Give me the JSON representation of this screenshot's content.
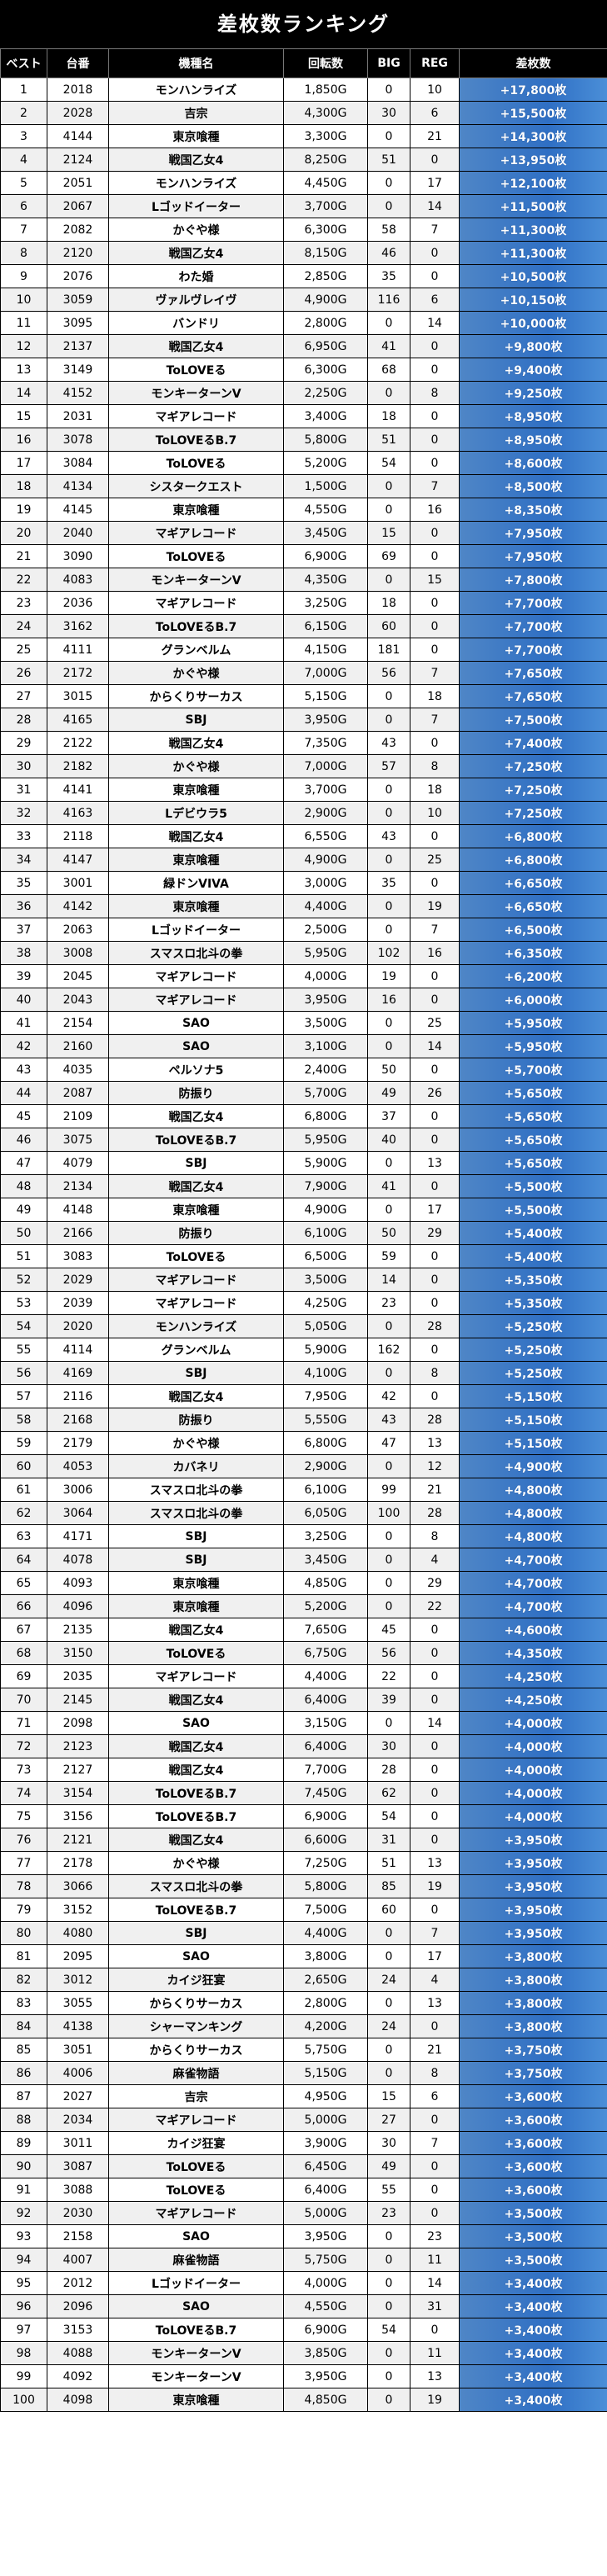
{
  "title": "差枚数ランキング",
  "headers": {
    "rank": "ベスト",
    "no": "台番",
    "model": "機種名",
    "spins": "回転数",
    "big": "BIG",
    "reg": "REG",
    "diff": "差枚数"
  },
  "rows": [
    [
      "1",
      "2018",
      "モンハンライズ",
      "1,850G",
      "0",
      "10",
      "+17,800枚"
    ],
    [
      "2",
      "2028",
      "吉宗",
      "4,300G",
      "30",
      "6",
      "+15,500枚"
    ],
    [
      "3",
      "4144",
      "東京喰種",
      "3,300G",
      "0",
      "21",
      "+14,300枚"
    ],
    [
      "4",
      "2124",
      "戦国乙女4",
      "8,250G",
      "51",
      "0",
      "+13,950枚"
    ],
    [
      "5",
      "2051",
      "モンハンライズ",
      "4,450G",
      "0",
      "17",
      "+12,100枚"
    ],
    [
      "6",
      "2067",
      "Lゴッドイーター",
      "3,700G",
      "0",
      "14",
      "+11,500枚"
    ],
    [
      "7",
      "2082",
      "かぐや様",
      "6,300G",
      "58",
      "7",
      "+11,300枚"
    ],
    [
      "8",
      "2120",
      "戦国乙女4",
      "8,150G",
      "46",
      "0",
      "+11,300枚"
    ],
    [
      "9",
      "2076",
      "わた婚",
      "2,850G",
      "35",
      "0",
      "+10,500枚"
    ],
    [
      "10",
      "3059",
      "ヴァルヴレイヴ",
      "4,900G",
      "116",
      "6",
      "+10,150枚"
    ],
    [
      "11",
      "3095",
      "バンドリ",
      "2,800G",
      "0",
      "14",
      "+10,000枚"
    ],
    [
      "12",
      "2137",
      "戦国乙女4",
      "6,950G",
      "41",
      "0",
      "+9,800枚"
    ],
    [
      "13",
      "3149",
      "ToLOVEる",
      "6,300G",
      "68",
      "0",
      "+9,400枚"
    ],
    [
      "14",
      "4152",
      "モンキーターンV",
      "2,250G",
      "0",
      "8",
      "+9,250枚"
    ],
    [
      "15",
      "2031",
      "マギアレコード",
      "3,400G",
      "18",
      "0",
      "+8,950枚"
    ],
    [
      "16",
      "3078",
      "ToLOVEるΒ.7",
      "5,800G",
      "51",
      "0",
      "+8,950枚"
    ],
    [
      "17",
      "3084",
      "ToLOVEる",
      "5,200G",
      "54",
      "0",
      "+8,600枚"
    ],
    [
      "18",
      "4134",
      "シスタークエスト",
      "1,500G",
      "0",
      "7",
      "+8,500枚"
    ],
    [
      "19",
      "4145",
      "東京喰種",
      "4,550G",
      "0",
      "16",
      "+8,350枚"
    ],
    [
      "20",
      "2040",
      "マギアレコード",
      "3,450G",
      "15",
      "0",
      "+7,950枚"
    ],
    [
      "21",
      "3090",
      "ToLOVEる",
      "6,900G",
      "69",
      "0",
      "+7,950枚"
    ],
    [
      "22",
      "4083",
      "モンキーターンV",
      "4,350G",
      "0",
      "15",
      "+7,800枚"
    ],
    [
      "23",
      "2036",
      "マギアレコード",
      "3,250G",
      "18",
      "0",
      "+7,700枚"
    ],
    [
      "24",
      "3162",
      "ToLOVEるΒ.7",
      "6,150G",
      "60",
      "0",
      "+7,700枚"
    ],
    [
      "25",
      "4111",
      "グランベルム",
      "4,150G",
      "181",
      "0",
      "+7,700枚"
    ],
    [
      "26",
      "2172",
      "かぐや様",
      "7,000G",
      "56",
      "7",
      "+7,650枚"
    ],
    [
      "27",
      "3015",
      "からくりサーカス",
      "5,150G",
      "0",
      "18",
      "+7,650枚"
    ],
    [
      "28",
      "4165",
      "SBJ",
      "3,950G",
      "0",
      "7",
      "+7,500枚"
    ],
    [
      "29",
      "2122",
      "戦国乙女4",
      "7,350G",
      "43",
      "0",
      "+7,400枚"
    ],
    [
      "30",
      "2182",
      "かぐや様",
      "7,000G",
      "57",
      "8",
      "+7,250枚"
    ],
    [
      "31",
      "4141",
      "東京喰種",
      "3,700G",
      "0",
      "18",
      "+7,250枚"
    ],
    [
      "32",
      "4163",
      "Lデビウラ5",
      "2,900G",
      "0",
      "10",
      "+7,250枚"
    ],
    [
      "33",
      "2118",
      "戦国乙女4",
      "6,550G",
      "43",
      "0",
      "+6,800枚"
    ],
    [
      "34",
      "4147",
      "東京喰種",
      "4,900G",
      "0",
      "25",
      "+6,800枚"
    ],
    [
      "35",
      "3001",
      "緑ドンVIVA",
      "3,000G",
      "35",
      "0",
      "+6,650枚"
    ],
    [
      "36",
      "4142",
      "東京喰種",
      "4,400G",
      "0",
      "19",
      "+6,650枚"
    ],
    [
      "37",
      "2063",
      "Lゴッドイーター",
      "2,500G",
      "0",
      "7",
      "+6,500枚"
    ],
    [
      "38",
      "3008",
      "スマスロ北斗の拳",
      "5,950G",
      "102",
      "16",
      "+6,350枚"
    ],
    [
      "39",
      "2045",
      "マギアレコード",
      "4,000G",
      "19",
      "0",
      "+6,200枚"
    ],
    [
      "40",
      "2043",
      "マギアレコード",
      "3,950G",
      "16",
      "0",
      "+6,000枚"
    ],
    [
      "41",
      "2154",
      "SAO",
      "3,500G",
      "0",
      "25",
      "+5,950枚"
    ],
    [
      "42",
      "2160",
      "SAO",
      "3,100G",
      "0",
      "14",
      "+5,950枚"
    ],
    [
      "43",
      "4035",
      "ペルソナ5",
      "2,400G",
      "50",
      "0",
      "+5,700枚"
    ],
    [
      "44",
      "2087",
      "防振り",
      "5,700G",
      "49",
      "26",
      "+5,650枚"
    ],
    [
      "45",
      "2109",
      "戦国乙女4",
      "6,800G",
      "37",
      "0",
      "+5,650枚"
    ],
    [
      "46",
      "3075",
      "ToLOVEるΒ.7",
      "5,950G",
      "40",
      "0",
      "+5,650枚"
    ],
    [
      "47",
      "4079",
      "SBJ",
      "5,900G",
      "0",
      "13",
      "+5,650枚"
    ],
    [
      "48",
      "2134",
      "戦国乙女4",
      "7,900G",
      "41",
      "0",
      "+5,500枚"
    ],
    [
      "49",
      "4148",
      "東京喰種",
      "4,900G",
      "0",
      "17",
      "+5,500枚"
    ],
    [
      "50",
      "2166",
      "防振り",
      "6,100G",
      "50",
      "29",
      "+5,400枚"
    ],
    [
      "51",
      "3083",
      "ToLOVEる",
      "6,500G",
      "59",
      "0",
      "+5,400枚"
    ],
    [
      "52",
      "2029",
      "マギアレコード",
      "3,500G",
      "14",
      "0",
      "+5,350枚"
    ],
    [
      "53",
      "2039",
      "マギアレコード",
      "4,250G",
      "23",
      "0",
      "+5,350枚"
    ],
    [
      "54",
      "2020",
      "モンハンライズ",
      "5,050G",
      "0",
      "28",
      "+5,250枚"
    ],
    [
      "55",
      "4114",
      "グランベルム",
      "5,900G",
      "162",
      "0",
      "+5,250枚"
    ],
    [
      "56",
      "4169",
      "SBJ",
      "4,100G",
      "0",
      "8",
      "+5,250枚"
    ],
    [
      "57",
      "2116",
      "戦国乙女4",
      "7,950G",
      "42",
      "0",
      "+5,150枚"
    ],
    [
      "58",
      "2168",
      "防振り",
      "5,550G",
      "43",
      "28",
      "+5,150枚"
    ],
    [
      "59",
      "2179",
      "かぐや様",
      "6,800G",
      "47",
      "13",
      "+5,150枚"
    ],
    [
      "60",
      "4053",
      "カバネリ",
      "2,900G",
      "0",
      "12",
      "+4,900枚"
    ],
    [
      "61",
      "3006",
      "スマスロ北斗の拳",
      "6,100G",
      "99",
      "21",
      "+4,800枚"
    ],
    [
      "62",
      "3064",
      "スマスロ北斗の拳",
      "6,050G",
      "100",
      "28",
      "+4,800枚"
    ],
    [
      "63",
      "4171",
      "SBJ",
      "3,250G",
      "0",
      "8",
      "+4,800枚"
    ],
    [
      "64",
      "4078",
      "SBJ",
      "3,450G",
      "0",
      "4",
      "+4,700枚"
    ],
    [
      "65",
      "4093",
      "東京喰種",
      "4,850G",
      "0",
      "29",
      "+4,700枚"
    ],
    [
      "66",
      "4096",
      "東京喰種",
      "5,200G",
      "0",
      "22",
      "+4,700枚"
    ],
    [
      "67",
      "2135",
      "戦国乙女4",
      "7,650G",
      "45",
      "0",
      "+4,600枚"
    ],
    [
      "68",
      "3150",
      "ToLOVEる",
      "6,750G",
      "56",
      "0",
      "+4,350枚"
    ],
    [
      "69",
      "2035",
      "マギアレコード",
      "4,400G",
      "22",
      "0",
      "+4,250枚"
    ],
    [
      "70",
      "2145",
      "戦国乙女4",
      "6,400G",
      "39",
      "0",
      "+4,250枚"
    ],
    [
      "71",
      "2098",
      "SAO",
      "3,150G",
      "0",
      "14",
      "+4,000枚"
    ],
    [
      "72",
      "2123",
      "戦国乙女4",
      "6,400G",
      "30",
      "0",
      "+4,000枚"
    ],
    [
      "73",
      "2127",
      "戦国乙女4",
      "7,700G",
      "28",
      "0",
      "+4,000枚"
    ],
    [
      "74",
      "3154",
      "ToLOVEるΒ.7",
      "7,450G",
      "62",
      "0",
      "+4,000枚"
    ],
    [
      "75",
      "3156",
      "ToLOVEるΒ.7",
      "6,900G",
      "54",
      "0",
      "+4,000枚"
    ],
    [
      "76",
      "2121",
      "戦国乙女4",
      "6,600G",
      "31",
      "0",
      "+3,950枚"
    ],
    [
      "77",
      "2178",
      "かぐや様",
      "7,250G",
      "51",
      "13",
      "+3,950枚"
    ],
    [
      "78",
      "3066",
      "スマスロ北斗の拳",
      "5,800G",
      "85",
      "19",
      "+3,950枚"
    ],
    [
      "79",
      "3152",
      "ToLOVEるΒ.7",
      "7,500G",
      "60",
      "0",
      "+3,950枚"
    ],
    [
      "80",
      "4080",
      "SBJ",
      "4,400G",
      "0",
      "7",
      "+3,950枚"
    ],
    [
      "81",
      "2095",
      "SAO",
      "3,800G",
      "0",
      "17",
      "+3,800枚"
    ],
    [
      "82",
      "3012",
      "カイジ狂宴",
      "2,650G",
      "24",
      "4",
      "+3,800枚"
    ],
    [
      "83",
      "3055",
      "からくりサーカス",
      "2,800G",
      "0",
      "13",
      "+3,800枚"
    ],
    [
      "84",
      "4138",
      "シャーマンキング",
      "4,200G",
      "24",
      "0",
      "+3,800枚"
    ],
    [
      "85",
      "3051",
      "からくりサーカス",
      "5,750G",
      "0",
      "21",
      "+3,750枚"
    ],
    [
      "86",
      "4006",
      "麻雀物語",
      "5,150G",
      "0",
      "8",
      "+3,750枚"
    ],
    [
      "87",
      "2027",
      "吉宗",
      "4,950G",
      "15",
      "6",
      "+3,600枚"
    ],
    [
      "88",
      "2034",
      "マギアレコード",
      "5,000G",
      "27",
      "0",
      "+3,600枚"
    ],
    [
      "89",
      "3011",
      "カイジ狂宴",
      "3,900G",
      "30",
      "7",
      "+3,600枚"
    ],
    [
      "90",
      "3087",
      "ToLOVEる",
      "6,450G",
      "49",
      "0",
      "+3,600枚"
    ],
    [
      "91",
      "3088",
      "ToLOVEる",
      "6,400G",
      "55",
      "0",
      "+3,600枚"
    ],
    [
      "92",
      "2030",
      "マギアレコード",
      "5,000G",
      "23",
      "0",
      "+3,500枚"
    ],
    [
      "93",
      "2158",
      "SAO",
      "3,950G",
      "0",
      "23",
      "+3,500枚"
    ],
    [
      "94",
      "4007",
      "麻雀物語",
      "5,750G",
      "0",
      "11",
      "+3,500枚"
    ],
    [
      "95",
      "2012",
      "Lゴッドイーター",
      "4,000G",
      "0",
      "14",
      "+3,400枚"
    ],
    [
      "96",
      "2096",
      "SAO",
      "4,550G",
      "0",
      "31",
      "+3,400枚"
    ],
    [
      "97",
      "3153",
      "ToLOVEるΒ.7",
      "6,900G",
      "54",
      "0",
      "+3,400枚"
    ],
    [
      "98",
      "4088",
      "モンキーターンV",
      "3,850G",
      "0",
      "11",
      "+3,400枚"
    ],
    [
      "99",
      "4092",
      "モンキーターンV",
      "3,950G",
      "0",
      "13",
      "+3,400枚"
    ],
    [
      "100",
      "4098",
      "東京喰種",
      "4,850G",
      "0",
      "19",
      "+3,400枚"
    ]
  ]
}
